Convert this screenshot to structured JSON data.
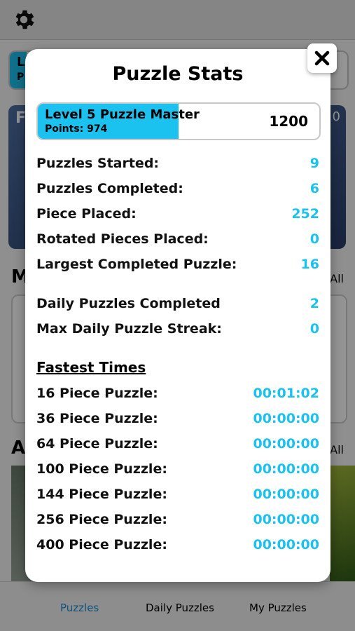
{
  "background": {
    "card_letter": "L",
    "card_letter2": "P",
    "feature_letter": "F",
    "feature_num": "0",
    "section_m": "M",
    "section_a": "A",
    "all_label_1": "All",
    "all_label_2": "All"
  },
  "tabs": [
    {
      "label": "Puzzles"
    },
    {
      "label": "Daily Puzzles"
    },
    {
      "label": "My Puzzles"
    }
  ],
  "modal": {
    "title": "Puzzle Stats",
    "level": {
      "label": "Level 5 Puzzle Master",
      "points_text": "Points: 974",
      "points": 974,
      "goal": "1200",
      "progress_fraction": 0.5
    },
    "stats": [
      {
        "label": "Puzzles Started:",
        "value": "9"
      },
      {
        "label": "Puzzles Completed:",
        "value": "6"
      },
      {
        "label": "Piece Placed:",
        "value": "252"
      },
      {
        "label": "Rotated Pieces Placed:",
        "value": "0"
      },
      {
        "label": "Largest Completed Puzzle:",
        "value": "16"
      }
    ],
    "daily": [
      {
        "label": "Daily Puzzles Completed",
        "value": "2"
      },
      {
        "label": "Max Daily Puzzle Streak:",
        "value": "0"
      }
    ],
    "fastest_title": "Fastest Times",
    "fastest": [
      {
        "label": "16 Piece Puzzle:",
        "value": "00:01:02"
      },
      {
        "label": "36 Piece Puzzle:",
        "value": "00:00:00"
      },
      {
        "label": "64 Piece Puzzle:",
        "value": "00:00:00"
      },
      {
        "label": "100 Piece Puzzle:",
        "value": "00:00:00"
      },
      {
        "label": "144 Piece Puzzle:",
        "value": "00:00:00"
      },
      {
        "label": "256 Piece Puzzle:",
        "value": "00:00:00"
      },
      {
        "label": "400 Piece Puzzle:",
        "value": "00:00:00"
      }
    ]
  },
  "colors": {
    "accent": "#1cc2ef",
    "tab_active": "#1a8fd6"
  },
  "icons": {
    "settings": "gear-icon",
    "close": "close-icon"
  }
}
